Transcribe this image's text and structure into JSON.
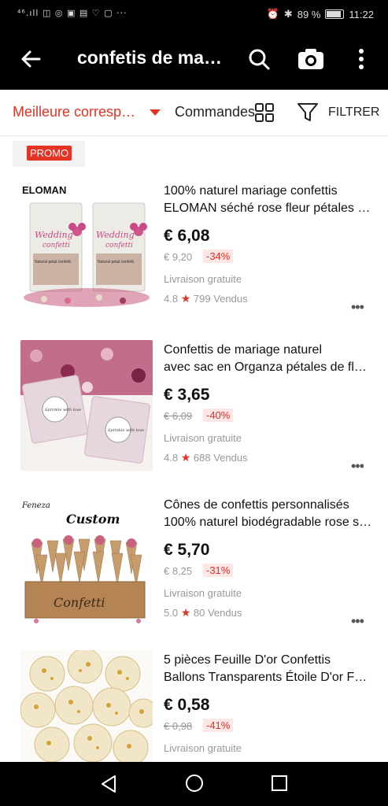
{
  "status_bar": {
    "left_icons": "⁴⁶.ıll ◫ ◎ ▣ ▤ ♡ ▢ ···",
    "battery": "89 %",
    "time": "11:22"
  },
  "app_bar": {
    "title": "confetis de ma…",
    "icons": [
      "back-arrow-icon",
      "search-icon",
      "camera-icon",
      "more-vert-icon"
    ]
  },
  "sort_bar": {
    "best_match": "Meilleure corresp…",
    "orders": "Commandes",
    "filter": "FILTRER"
  },
  "promo_label": "PROMO",
  "products": [
    {
      "title_line1": "100% naturel mariage confettis",
      "title_line2": "ELOMAN séché rose fleur pétales …",
      "price": "€ 6,08",
      "old_price": "€ 9,20",
      "discount": "-34%",
      "shipping": "Livraison gratuite",
      "rating": "4.8",
      "sold": "799 Vendus",
      "thumb_brand": "ELOMAN",
      "thumb_text1": "Wedding",
      "thumb_text2": "confetti",
      "thumb_small": "Natural petal confetti"
    },
    {
      "title_line1": "Confettis de mariage naturel",
      "title_line2": "avec sac en Organza pétales de fl…",
      "price": "€ 3,65",
      "old_price": "€ 6,09",
      "discount": "-40%",
      "shipping": "Livraison gratuite",
      "rating": "4.8",
      "sold": "688 Vendus",
      "thumb_text1": "Sprinkle with love",
      "thumb_text2": "Sprinkle with love"
    },
    {
      "title_line1": "Cônes de confettis personnalisés",
      "title_line2": "100% naturel biodégradable rose s…",
      "price": "€ 5,70",
      "old_price": "€ 8,25",
      "discount": "-31%",
      "shipping": "Livraison gratuite",
      "rating": "5.0",
      "sold": "80 Vendus",
      "thumb_brand": "Feneza",
      "thumb_text1": "Custom",
      "thumb_text2": "Confetti"
    },
    {
      "title_line1": "5 pièces Feuille D'or Confettis",
      "title_line2": "Ballons Transparents Étoile D'or F…",
      "price": "€ 0,58",
      "old_price": "€ 0,98",
      "discount": "-41%",
      "shipping": "Livraison gratuite"
    }
  ],
  "colors": {
    "accent": "#e43225",
    "discount_bg": "#fde6e6",
    "bar_bg": "#000000"
  }
}
